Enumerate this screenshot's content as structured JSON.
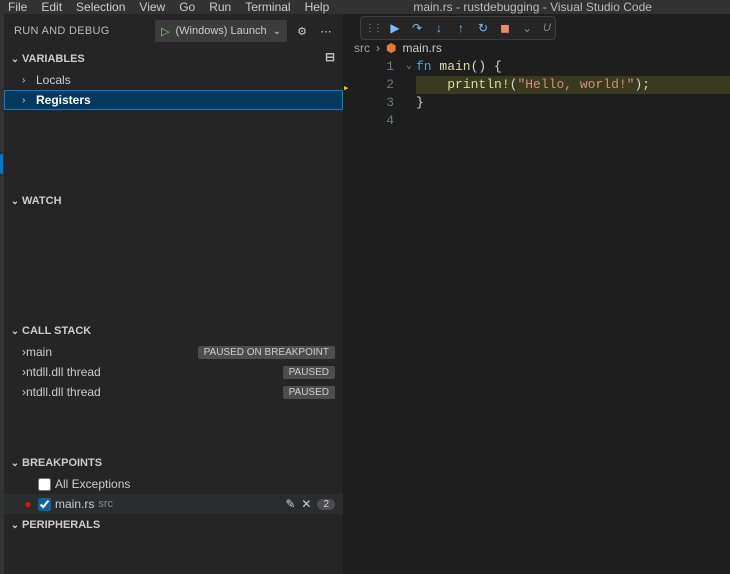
{
  "title": "main.rs - rustdebugging - Visual Studio Code",
  "menubar": [
    "File",
    "Edit",
    "Selection",
    "View",
    "Go",
    "Run",
    "Terminal",
    "Help"
  ],
  "debugToolbar": {
    "label": "U"
  },
  "sidebar": {
    "header": "Run and Debug",
    "config": "(Windows) Launch",
    "sections": {
      "variables": {
        "title": "VARIABLES",
        "items": [
          "Locals",
          "Registers"
        ],
        "selectedIndex": 1
      },
      "watch": {
        "title": "WATCH"
      },
      "callstack": {
        "title": "CALL STACK",
        "items": [
          {
            "label": "main",
            "status": "Paused on breakpoint"
          },
          {
            "label": "ntdll.dll thread",
            "status": "Paused"
          },
          {
            "label": "ntdll.dll thread",
            "status": "Paused"
          }
        ]
      },
      "breakpoints": {
        "title": "BREAKPOINTS",
        "allExceptions": "All Exceptions",
        "items": [
          {
            "file": "main.rs",
            "path": "src",
            "count": "2"
          }
        ]
      },
      "peripherals": {
        "title": "PERIPHERALS"
      }
    }
  },
  "editor": {
    "breadcrumb": {
      "folder": "src",
      "file": "main.rs"
    },
    "lines": [
      {
        "num": "1",
        "parts": [
          [
            "kw",
            "fn "
          ],
          [
            "fn",
            "main"
          ],
          [
            "punct",
            "() {"
          ]
        ]
      },
      {
        "num": "2",
        "hl": true,
        "indent": "    ",
        "parts": [
          [
            "mac",
            "println!"
          ],
          [
            "punct",
            "("
          ],
          [
            "str",
            "\"Hello, world!\""
          ],
          [
            "punct",
            ");"
          ]
        ]
      },
      {
        "num": "3",
        "parts": [
          [
            "punct",
            "}"
          ]
        ]
      },
      {
        "num": "4",
        "parts": []
      }
    ]
  }
}
